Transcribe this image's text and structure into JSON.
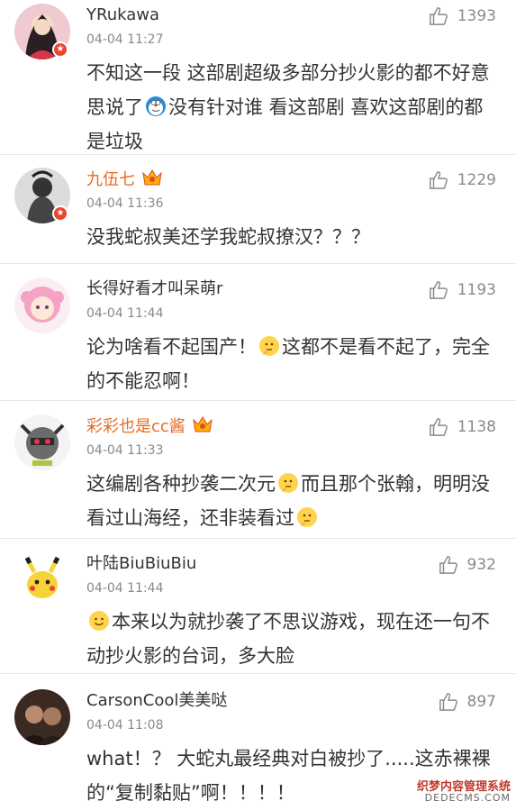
{
  "comments": [
    {
      "user": "YRukawa",
      "time": "04-04 11:27",
      "likes": "1393",
      "text_parts": [
        "不知这一段 这部剧超级多部分抄火影的都不好意思说了",
        "没有针对谁 看这部剧 喜欢这部剧的都是垃圾"
      ]
    },
    {
      "user": "九伍七",
      "time": "04-04 11:36",
      "likes": "1229",
      "text": "没我蛇叔美还学我蛇叔撩汉？？？"
    },
    {
      "user": "长得好看才叫呆萌r",
      "time": "04-04 11:44",
      "likes": "1193",
      "text_parts": [
        "论为啥看不起国产！",
        "这都不是看不起了，完全的不能忍啊！"
      ]
    },
    {
      "user": "彩彩也是cc酱",
      "time": "04-04 11:33",
      "likes": "1138",
      "text_parts": [
        "这编剧各种抄袭二次元",
        "而且那个张翰，明明没看过山海经，还非装看过",
        ""
      ]
    },
    {
      "user": "叶陆BiuBiuBiu",
      "time": "04-04 11:44",
      "likes": "932",
      "text_parts": [
        "",
        "本来以为就抄袭了不思议游戏，现在还一句不动抄火影的台词，多大脸"
      ]
    },
    {
      "user": "CarsonCool美美哒",
      "time": "04-04 11:08",
      "likes": "897",
      "text": "what！？ 大蛇丸最经典对白被抄了.....这赤裸裸的“复制黏贴”啊！！！！"
    }
  ],
  "watermark": {
    "cn": "织梦内容管理系统",
    "en": "DEDECMS.COM"
  },
  "icons": {
    "like": "thumbs-up-icon",
    "verified": "verified-badge-icon",
    "vip": "vip-crown-icon"
  },
  "colors": {
    "vip_name": "#e86b1f",
    "badge": "#e8452f"
  }
}
